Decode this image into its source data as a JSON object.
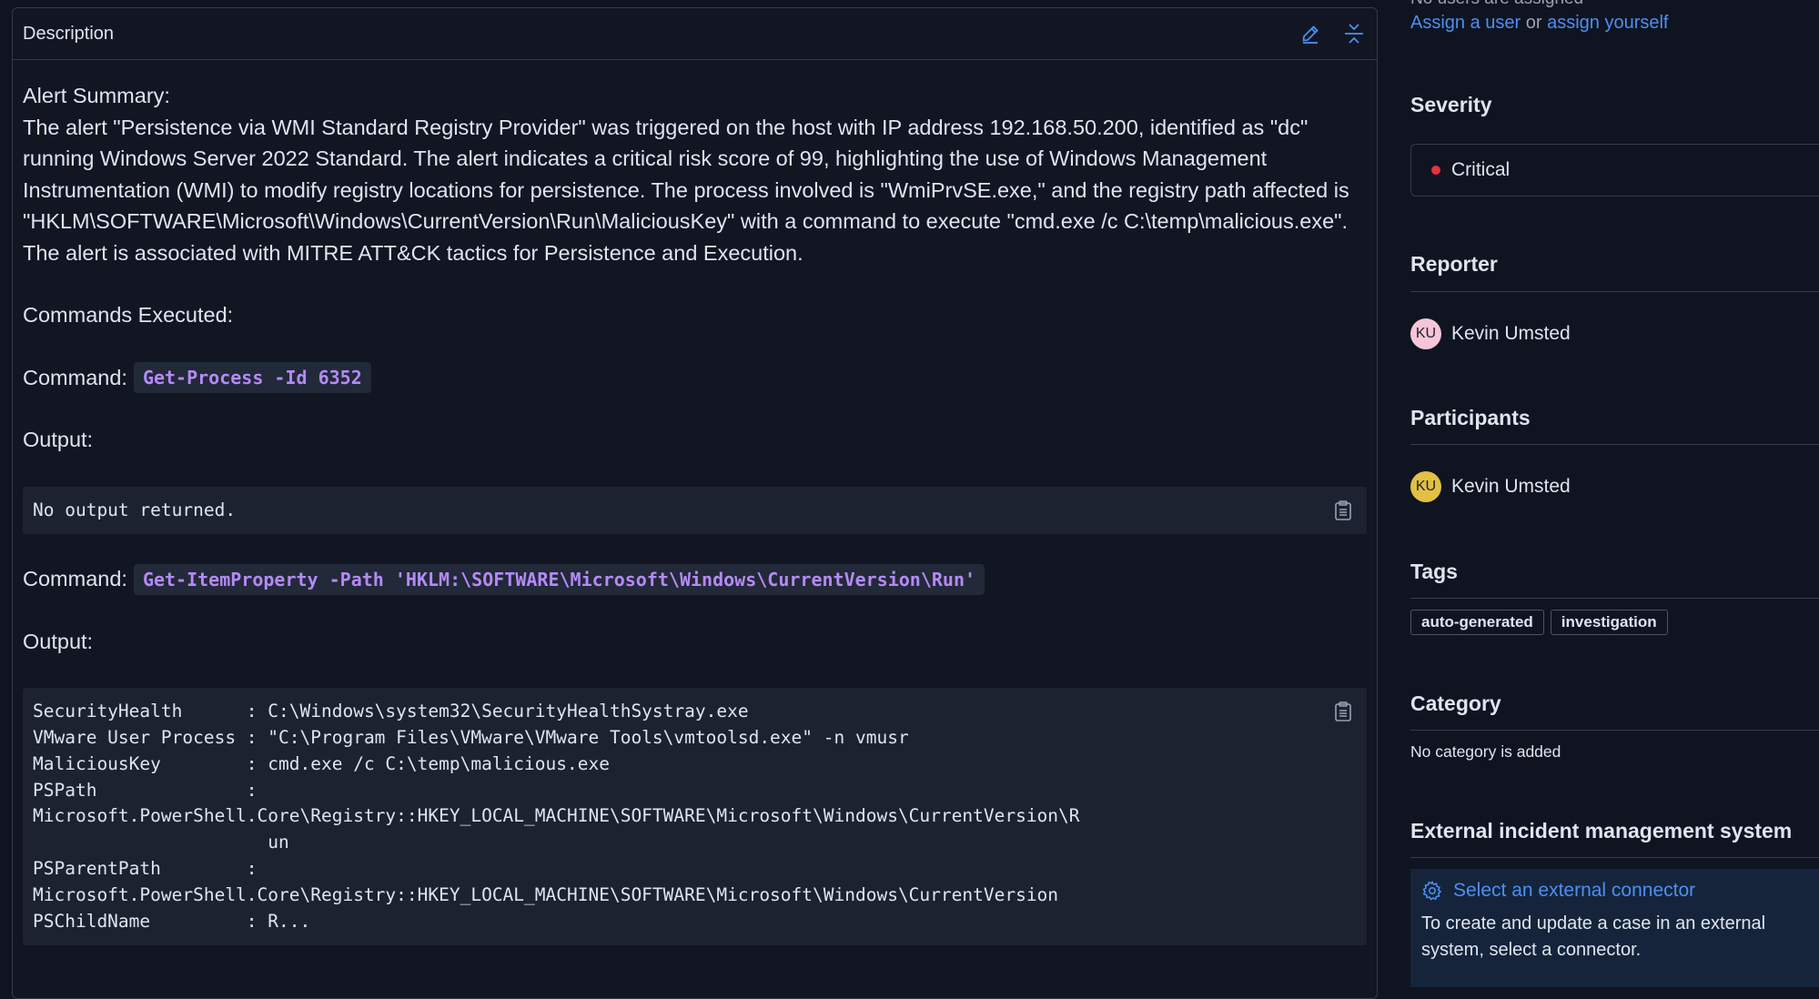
{
  "description": {
    "title": "Description",
    "summary_heading": "Alert Summary:",
    "summary_text": "The alert \"Persistence via WMI Standard Registry Provider\" was triggered on the host with IP address 192.168.50.200, identified as \"dc\" running Windows Server 2022 Standard. The alert indicates a critical risk score of 99, highlighting the use of Windows Management Instrumentation (WMI) to modify registry locations for persistence. The process involved is \"WmiPrvSE.exe,\" and the registry path affected is \"HKLM\\SOFTWARE\\Microsoft\\Windows\\CurrentVersion\\Run\\MaliciousKey\" with a command to execute \"cmd.exe /c C:\\temp\\malicious.exe\". The alert is associated with MITRE ATT&CK tactics for Persistence and Execution.",
    "commands_heading": "Commands Executed:",
    "command_label": "Command:",
    "output_label": "Output:",
    "commands": [
      {
        "command": "Get-Process -Id 6352",
        "output": "No output returned."
      },
      {
        "command": "Get-ItemProperty -Path 'HKLM:\\SOFTWARE\\Microsoft\\Windows\\CurrentVersion\\Run'",
        "output": "SecurityHealth      : C:\\Windows\\system32\\SecurityHealthSystray.exe\nVMware User Process : \"C:\\Program Files\\VMware\\VMware Tools\\vmtoolsd.exe\" -n vmusr\nMaliciousKey        : cmd.exe /c C:\\temp\\malicious.exe\nPSPath              :\nMicrosoft.PowerShell.Core\\Registry::HKEY_LOCAL_MACHINE\\SOFTWARE\\Microsoft\\Windows\\CurrentVersion\\R\n                      un\nPSParentPath        :\nMicrosoft.PowerShell.Core\\Registry::HKEY_LOCAL_MACHINE\\SOFTWARE\\Microsoft\\Windows\\CurrentVersion\nPSChildName         : R..."
      }
    ]
  },
  "sidebar": {
    "no_users": "No users are assigned",
    "assign_user": "Assign a user",
    "or": " or ",
    "assign_yourself": "assign yourself",
    "severity": {
      "title": "Severity",
      "value": "Critical",
      "color": "#e7313c"
    },
    "reporter": {
      "title": "Reporter",
      "initials": "KU",
      "name": "Kevin Umsted",
      "avatar_color": "#f7c5d8"
    },
    "participants": {
      "title": "Participants",
      "initials": "KU",
      "name": "Kevin Umsted",
      "avatar_color": "#e2c044"
    },
    "tags": {
      "title": "Tags",
      "items": [
        "auto-generated",
        "investigation"
      ]
    },
    "category": {
      "title": "Category",
      "empty": "No category is added"
    },
    "external": {
      "title": "External incident management system",
      "link": "Select an external connector",
      "text": "To create and update a case in an external system, select a connector."
    }
  }
}
